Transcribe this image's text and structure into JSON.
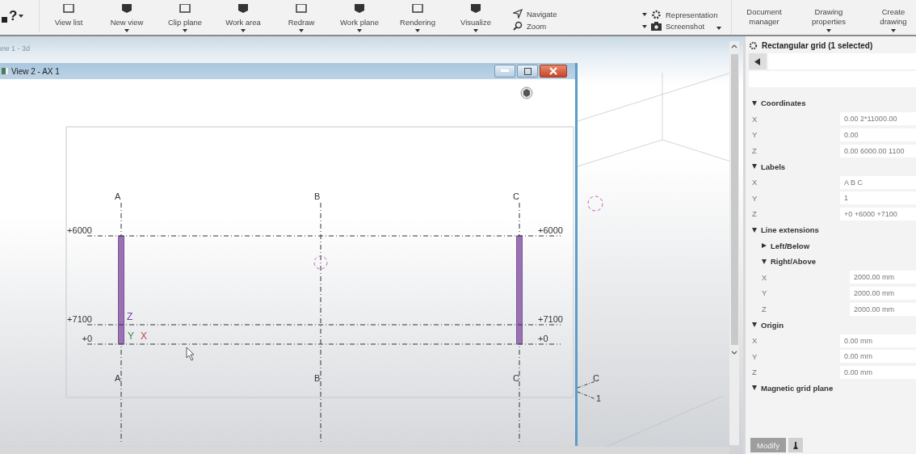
{
  "ribbon": {
    "help": "?",
    "items": [
      {
        "kind": "large",
        "label": "View list",
        "dropdown": false
      },
      {
        "kind": "large",
        "label": "New view",
        "dropdown": true
      },
      {
        "kind": "large",
        "label": "Clip plane",
        "dropdown": true
      },
      {
        "kind": "large",
        "label": "Work area",
        "dropdown": true
      },
      {
        "kind": "large",
        "label": "Redraw",
        "dropdown": true
      },
      {
        "kind": "large",
        "label": "Work plane",
        "dropdown": true
      },
      {
        "kind": "large",
        "label": "Rendering",
        "dropdown": true
      },
      {
        "kind": "large",
        "label": "Visualize",
        "dropdown": true
      },
      {
        "kind": "stack",
        "dropdown": false,
        "entries": [
          "Navigate",
          "Zoom"
        ]
      },
      {
        "kind": "stack",
        "dropdown": true,
        "entries": [
          "Representation",
          "Screenshot"
        ]
      }
    ],
    "right_items": [
      {
        "label": "Document manager",
        "dropdown": false
      },
      {
        "label": "Drawing properties",
        "dropdown": true
      },
      {
        "label": "Create drawing",
        "dropdown": true
      }
    ]
  },
  "background_view": {
    "title": "ew 1 - 3d",
    "grid_labels": [
      "C",
      "1"
    ]
  },
  "view_window": {
    "title": "View 2 - AX 1",
    "columns": [
      {
        "top": "A",
        "bottom": "A",
        "member": true
      },
      {
        "top": "B",
        "bottom": "B",
        "member": false
      },
      {
        "top": "C",
        "bottom": "C",
        "member": true
      }
    ],
    "levels": [
      {
        "left": "+6000",
        "right": "+6000"
      },
      {
        "left": "+7100",
        "right": "+7100"
      },
      {
        "left": "+0",
        "right": "+0"
      }
    ],
    "axes": [
      "Z",
      "Y",
      "X"
    ]
  },
  "panel": {
    "title": "Rectangular grid (1 selected)",
    "sections": [
      {
        "title": "Coordinates",
        "expanded": true,
        "rows": [
          {
            "label": "X",
            "value": "0.00 2*11000.00"
          },
          {
            "label": "Y",
            "value": "0.00"
          },
          {
            "label": "Z",
            "value": "0.00 6000.00 1100"
          }
        ]
      },
      {
        "title": "Labels",
        "expanded": true,
        "rows": [
          {
            "label": "X",
            "value": "A B C"
          },
          {
            "label": "Y",
            "value": "1"
          },
          {
            "label": "Z",
            "value": "+0 +6000 +7100"
          }
        ]
      },
      {
        "title": "Line extensions",
        "expanded": true,
        "children": [
          {
            "title": "Left/Below",
            "expanded": false
          },
          {
            "title": "Right/Above",
            "expanded": true,
            "rows": [
              {
                "label": "X",
                "value": "2000.00 mm"
              },
              {
                "label": "Y",
                "value": "2000.00 mm"
              },
              {
                "label": "Z",
                "value": "2000.00 mm"
              }
            ]
          }
        ]
      },
      {
        "title": "Origin",
        "expanded": true,
        "rows": [
          {
            "label": "X",
            "value": "0.00 mm"
          },
          {
            "label": "Y",
            "value": "0.00 mm"
          },
          {
            "label": "Z",
            "value": "0.00 mm"
          }
        ]
      },
      {
        "title": "Magnetic grid plane",
        "expanded": true
      }
    ],
    "modify_button": {
      "label": "Modify",
      "disabled": true
    }
  }
}
